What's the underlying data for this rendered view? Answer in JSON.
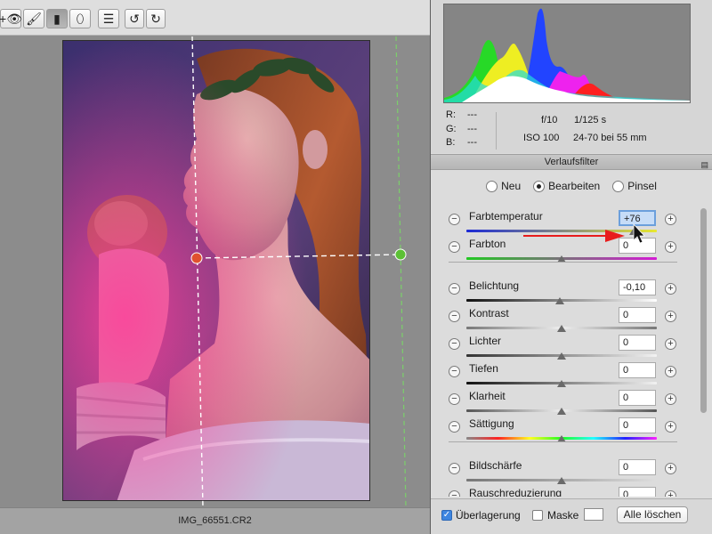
{
  "toolbar": {
    "tools": [
      {
        "name": "target-adjust-tool",
        "icon": "eye-plus-icon",
        "glyph": "+👁"
      },
      {
        "name": "brush-tool",
        "icon": "brush-icon",
        "glyph": "🖌"
      },
      {
        "name": "graduated-filter-tool",
        "icon": "graduated-filter-icon",
        "glyph": "▮"
      },
      {
        "name": "radial-filter-tool",
        "icon": "radial-filter-icon",
        "glyph": "⬯"
      },
      {
        "name": "preferences-list-tool",
        "icon": "list-icon",
        "glyph": "☰"
      },
      {
        "name": "rotate-left-tool",
        "icon": "rotate-ccw-icon",
        "glyph": "↺"
      },
      {
        "name": "rotate-right-tool",
        "icon": "rotate-cw-icon",
        "glyph": "↻"
      }
    ]
  },
  "status": {
    "filename": "IMG_66551.CR2"
  },
  "histogram": {
    "colors": {
      "red": "#ff2020",
      "green": "#22dd22",
      "blue": "#2244ff",
      "cyan": "#22dddd",
      "magenta": "#ee22ee",
      "yellow": "#eeee22",
      "white": "#ffffff"
    }
  },
  "info": {
    "r_label": "R:",
    "g_label": "G:",
    "b_label": "B:",
    "r_value": "---",
    "g_value": "---",
    "b_value": "---",
    "aperture": "f/10",
    "shutter": "1/125 s",
    "iso": "ISO 100",
    "lens": "24-70 bei 55 mm"
  },
  "panel": {
    "title": "Verlaufsfilter",
    "menu_icon": "panel-menu-icon",
    "modes": [
      {
        "label": "Neu",
        "selected": false
      },
      {
        "label": "Bearbeiten",
        "selected": true
      },
      {
        "label": "Pinsel",
        "selected": false
      }
    ]
  },
  "sliders": [
    {
      "label": "Farbtemperatur",
      "value": "+76",
      "thumb_fraction": 0.88,
      "selected": true
    },
    {
      "label": "Farbton",
      "value": "0",
      "thumb_fraction": 0.5,
      "selected": false
    },
    {
      "label": "Belichtung",
      "value": "-0,10",
      "thumb_fraction": 0.49,
      "selected": false
    },
    {
      "label": "Kontrast",
      "value": "0",
      "thumb_fraction": 0.5,
      "selected": false
    },
    {
      "label": "Lichter",
      "value": "0",
      "thumb_fraction": 0.5,
      "selected": false
    },
    {
      "label": "Tiefen",
      "value": "0",
      "thumb_fraction": 0.5,
      "selected": false
    },
    {
      "label": "Klarheit",
      "value": "0",
      "thumb_fraction": 0.5,
      "selected": false
    },
    {
      "label": "Sättigung",
      "value": "0",
      "thumb_fraction": 0.5,
      "selected": false
    },
    {
      "label": "Bildschärfe",
      "value": "0",
      "thumb_fraction": 0.5,
      "selected": false
    },
    {
      "label": "Rauschreduzierung",
      "value": "0",
      "thumb_fraction": 0.5,
      "selected": false
    }
  ],
  "footer": {
    "overlay_label": "Überlagerung",
    "overlay_checked": true,
    "mask_label": "Maske",
    "mask_checked": false,
    "clear_label": "Alle löschen"
  },
  "colors": {
    "temp_gradient_start": "#1d2bd6",
    "temp_gradient_end": "#e8e830",
    "tint_gradient_start": "#22c822",
    "tint_gradient_end": "#d41bd4",
    "saturation_gradient": [
      "#888888",
      "#ff2222",
      "#ffff22",
      "#22ff22",
      "#22ffff",
      "#2222ff",
      "#ff22ff"
    ],
    "pin_start": "#e0512f",
    "pin_end": "#5cc035",
    "arrow": "#e81c1c",
    "selection_blue": "#6b9fdc"
  }
}
